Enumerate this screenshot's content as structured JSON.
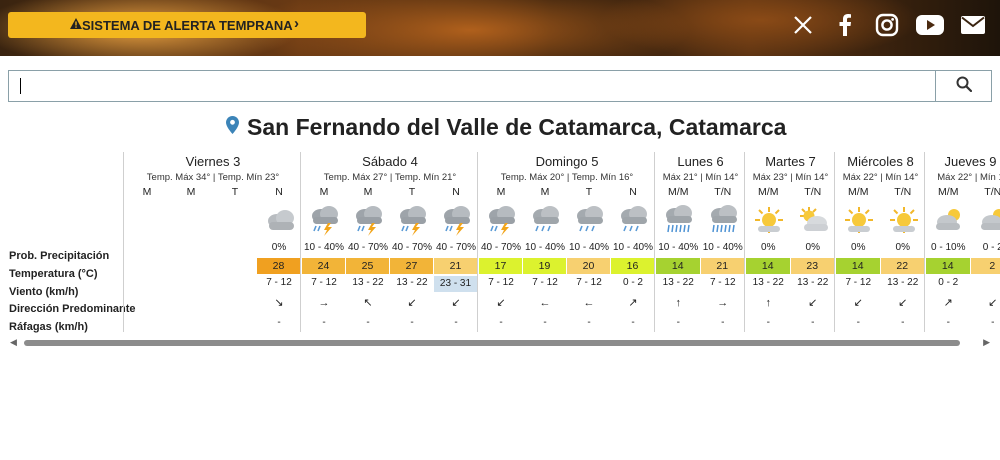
{
  "header": {
    "alert_button": "SISTEMA DE ALERTA TEMPRANA",
    "social": [
      "x-icon",
      "facebook-icon",
      "instagram-icon",
      "youtube-icon",
      "mail-icon"
    ]
  },
  "search": {
    "value": "",
    "placeholder": ""
  },
  "location": {
    "title": "San Fernando del Valle de Catamarca, Catamarca"
  },
  "row_labels": {
    "prob": "Prob. Precipitación",
    "temp": "Temperatura (°C)",
    "wind": "Viento (km/h)",
    "dir": "Dirección Predominante",
    "gust": "Ráfagas (km/h)"
  },
  "colors": {
    "alert": "#f3b71e",
    "t28": "#f0a020",
    "t24": "#f2b438",
    "t21": "#f7d070",
    "t23": "#cfe0ee",
    "t17": "#dcf22e",
    "t14": "#a6d230"
  },
  "days": [
    {
      "name": "Viernes 3",
      "temps": "Temp. Máx 34° | Temp. Mín 23°",
      "slots": [
        {
          "label": "M",
          "icon": "",
          "prob": "",
          "temp": "",
          "wind": "",
          "dir": "",
          "gust": ""
        },
        {
          "label": "M",
          "icon": "",
          "prob": "",
          "temp": "",
          "wind": "",
          "dir": "",
          "gust": ""
        },
        {
          "label": "T",
          "icon": "",
          "prob": "",
          "temp": "",
          "wind": "",
          "dir": "",
          "gust": ""
        },
        {
          "label": "N",
          "icon": "cloudy",
          "prob": "0%",
          "temp": "28",
          "tcolor": "#f0a020",
          "wind": "7 - 12",
          "dir": "↘",
          "gust": "-"
        }
      ]
    },
    {
      "name": "Sábado 4",
      "temps": "Temp. Máx 27° | Temp. Mín 21°",
      "slots": [
        {
          "label": "M",
          "icon": "storm",
          "prob": "10 - 40%",
          "temp": "24",
          "tcolor": "#f2b438",
          "wind": "7 - 12",
          "dir": "→",
          "gust": "-"
        },
        {
          "label": "M",
          "icon": "storm",
          "prob": "40 - 70%",
          "temp": "25",
          "tcolor": "#f2b438",
          "wind": "13 - 22",
          "dir": "↖",
          "gust": "-"
        },
        {
          "label": "T",
          "icon": "storm",
          "prob": "40 - 70%",
          "temp": "27",
          "tcolor": "#f2b438",
          "wind": "13 - 22",
          "dir": "↙",
          "gust": "-"
        },
        {
          "label": "N",
          "icon": "storm",
          "prob": "40 - 70%",
          "temp": "21",
          "tcolor": "#f7d070",
          "wind": "23 - 31",
          "wcolor": "#cfe0ee",
          "dir": "↙",
          "gust": "-"
        }
      ]
    },
    {
      "name": "Domingo 5",
      "temps": "Temp. Máx 20° | Temp. Mín 16°",
      "slots": [
        {
          "label": "M",
          "icon": "storm",
          "prob": "40 - 70%",
          "temp": "17",
          "tcolor": "#dcf22e",
          "wind": "7 - 12",
          "dir": "↙",
          "gust": "-"
        },
        {
          "label": "M",
          "icon": "rain",
          "prob": "10 - 40%",
          "temp": "19",
          "tcolor": "#dcf22e",
          "wind": "7 - 12",
          "dir": "←",
          "gust": "-"
        },
        {
          "label": "T",
          "icon": "rain",
          "prob": "10 - 40%",
          "temp": "20",
          "tcolor": "#f7d070",
          "wind": "7 - 12",
          "dir": "←",
          "gust": "-"
        },
        {
          "label": "N",
          "icon": "rain",
          "prob": "10 - 40%",
          "temp": "16",
          "tcolor": "#dcf22e",
          "wind": "0 - 2",
          "dir": "↗",
          "gust": "-"
        }
      ]
    },
    {
      "name": "Lunes 6",
      "temps": "Máx 21° | Mín 14°",
      "slots": [
        {
          "label": "M/M",
          "icon": "heavyrain",
          "prob": "10 - 40%",
          "temp": "14",
          "tcolor": "#a6d230",
          "wind": "13 - 22",
          "dir": "↑",
          "gust": "-"
        },
        {
          "label": "T/N",
          "icon": "heavyrain",
          "prob": "10 - 40%",
          "temp": "21",
          "tcolor": "#f7d070",
          "wind": "7 - 12",
          "dir": "→",
          "gust": "-"
        }
      ]
    },
    {
      "name": "Martes 7",
      "temps": "Máx 23° | Mín 14°",
      "slots": [
        {
          "label": "M/M",
          "icon": "sun",
          "prob": "0%",
          "temp": "14",
          "tcolor": "#a6d230",
          "wind": "13 - 22",
          "dir": "↑",
          "gust": "-"
        },
        {
          "label": "T/N",
          "icon": "partly",
          "prob": "0%",
          "temp": "23",
          "tcolor": "#f7d070",
          "wind": "13 - 22",
          "dir": "↙",
          "gust": "-"
        }
      ]
    },
    {
      "name": "Miércoles 8",
      "temps": "Máx 22° | Mín 14°",
      "slots": [
        {
          "label": "M/M",
          "icon": "sun",
          "prob": "0%",
          "temp": "14",
          "tcolor": "#a6d230",
          "wind": "7 - 12",
          "dir": "↙",
          "gust": "-"
        },
        {
          "label": "T/N",
          "icon": "sun",
          "prob": "0%",
          "temp": "22",
          "tcolor": "#f7d070",
          "wind": "13 - 22",
          "dir": "↙",
          "gust": "-"
        }
      ]
    },
    {
      "name": "Jueves 9",
      "temps": "Máx 22° | Mín 1",
      "slots": [
        {
          "label": "M/M",
          "icon": "partlycloud",
          "prob": "0 - 10%",
          "temp": "14",
          "tcolor": "#a6d230",
          "wind": "0 - 2",
          "dir": "↗",
          "gust": "-"
        },
        {
          "label": "T/N",
          "icon": "partlycloud",
          "prob": "0 - 2",
          "temp": "2",
          "tcolor": "#f7d070",
          "wind": "",
          "dir": "↙",
          "gust": "-"
        }
      ]
    }
  ]
}
